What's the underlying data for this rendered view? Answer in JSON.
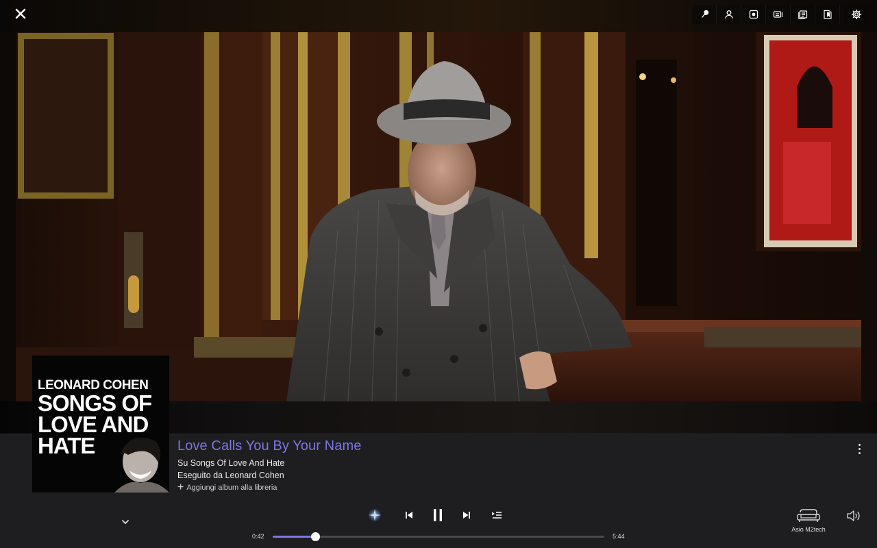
{
  "window": {
    "close_icon": "close-icon"
  },
  "toolbar": {
    "buttons": [
      {
        "name": "radio-icon"
      },
      {
        "name": "artist-icon"
      },
      {
        "name": "album-icon"
      },
      {
        "name": "credits-icon"
      },
      {
        "name": "lyrics-icon"
      },
      {
        "name": "review-icon"
      },
      {
        "name": "settings-icon"
      }
    ]
  },
  "album_cover": {
    "artist": "LEONARD COHEN",
    "title_lines": [
      "SONGS OF",
      "LOVE AND",
      "HATE"
    ]
  },
  "track": {
    "title": "Love Calls You By Your Name",
    "album_line": "Su Songs Of Love And Hate",
    "artist_line": "Eseguito da Leonard Cohen",
    "add_to_library": "Aggiungi album alla libreria"
  },
  "playback": {
    "elapsed": "0:42",
    "duration": "5:44",
    "progress_fraction": 0.1279,
    "state": "playing"
  },
  "output": {
    "device": "Asio M2tech"
  },
  "colors": {
    "accent": "#7b77e6",
    "player_bg": "#1e1e20"
  }
}
